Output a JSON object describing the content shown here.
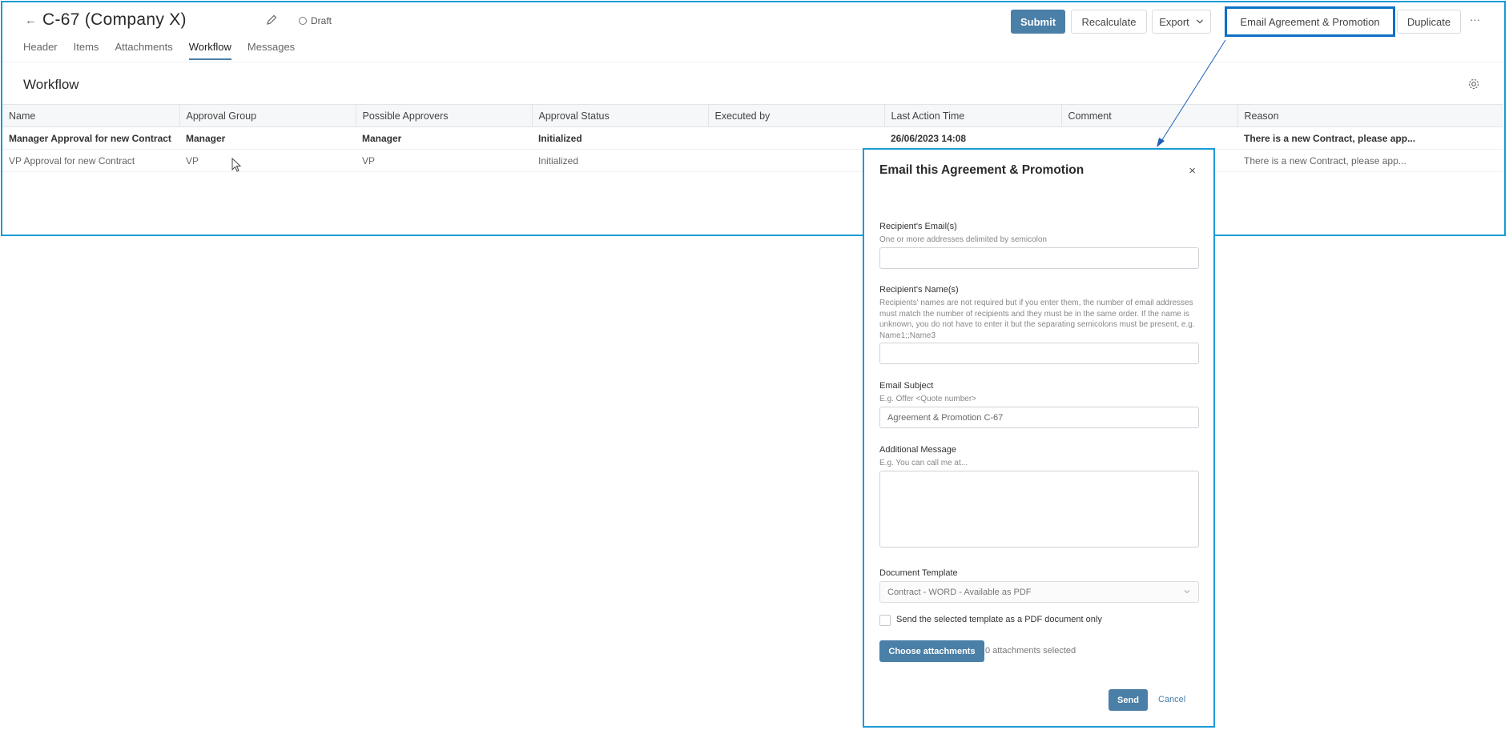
{
  "header": {
    "title": "C-67 (Company X)",
    "status": "Draft"
  },
  "toolbar": {
    "submit": "Submit",
    "recalculate": "Recalculate",
    "export": "Export",
    "email": "Email Agreement & Promotion",
    "duplicate": "Duplicate",
    "more": "···"
  },
  "tabs": [
    "Header",
    "Items",
    "Attachments",
    "Workflow",
    "Messages"
  ],
  "active_tab": "Workflow",
  "section": {
    "title": "Workflow"
  },
  "table": {
    "columns": [
      "Name",
      "Approval Group",
      "Possible Approvers",
      "Approval Status",
      "Executed by",
      "Last Action Time",
      "Comment",
      "Reason"
    ],
    "rows": [
      [
        "Manager Approval for new Contract",
        "Manager",
        "Manager",
        "Initialized",
        "",
        "26/06/2023 14:08",
        "",
        "There is a new Contract, please app..."
      ],
      [
        "VP Approval for new Contract",
        "VP",
        "VP",
        "Initialized",
        "",
        "",
        "",
        "There is a new Contract, please app..."
      ]
    ]
  },
  "modal": {
    "title": "Email this Agreement & Promotion",
    "close": "×",
    "recipients_email": {
      "label": "Recipient's Email(s)",
      "help": "One or more addresses delimited by semicolon",
      "value": ""
    },
    "recipients_name": {
      "label": "Recipient's Name(s)",
      "help": "Recipients' names are not required but if you enter them, the number of email addresses must match the number of recipients and they must be in the same order. If the name is unknown, you do not have to enter it but the separating semicolons must be present, e.g. Name1;;Name3",
      "value": ""
    },
    "subject": {
      "label": "Email Subject",
      "help": "E.g. Offer <Quote number>",
      "value": "Agreement & Promotion C-67"
    },
    "message": {
      "label": "Additional Message",
      "help": "E.g. You can call me at...",
      "value": ""
    },
    "template": {
      "label": "Document Template",
      "value": "Contract - WORD - Available as PDF"
    },
    "pdf_only": {
      "label": "Send the selected template as a PDF document only",
      "checked": false
    },
    "attachments_button": "Choose attachments",
    "attachments_count": "0 attachments selected",
    "send": "Send",
    "cancel": "Cancel"
  },
  "colors": {
    "primary": "#4a7fa8",
    "highlight_border": "#1a9ad6",
    "callout_border": "#0f6fc6"
  }
}
